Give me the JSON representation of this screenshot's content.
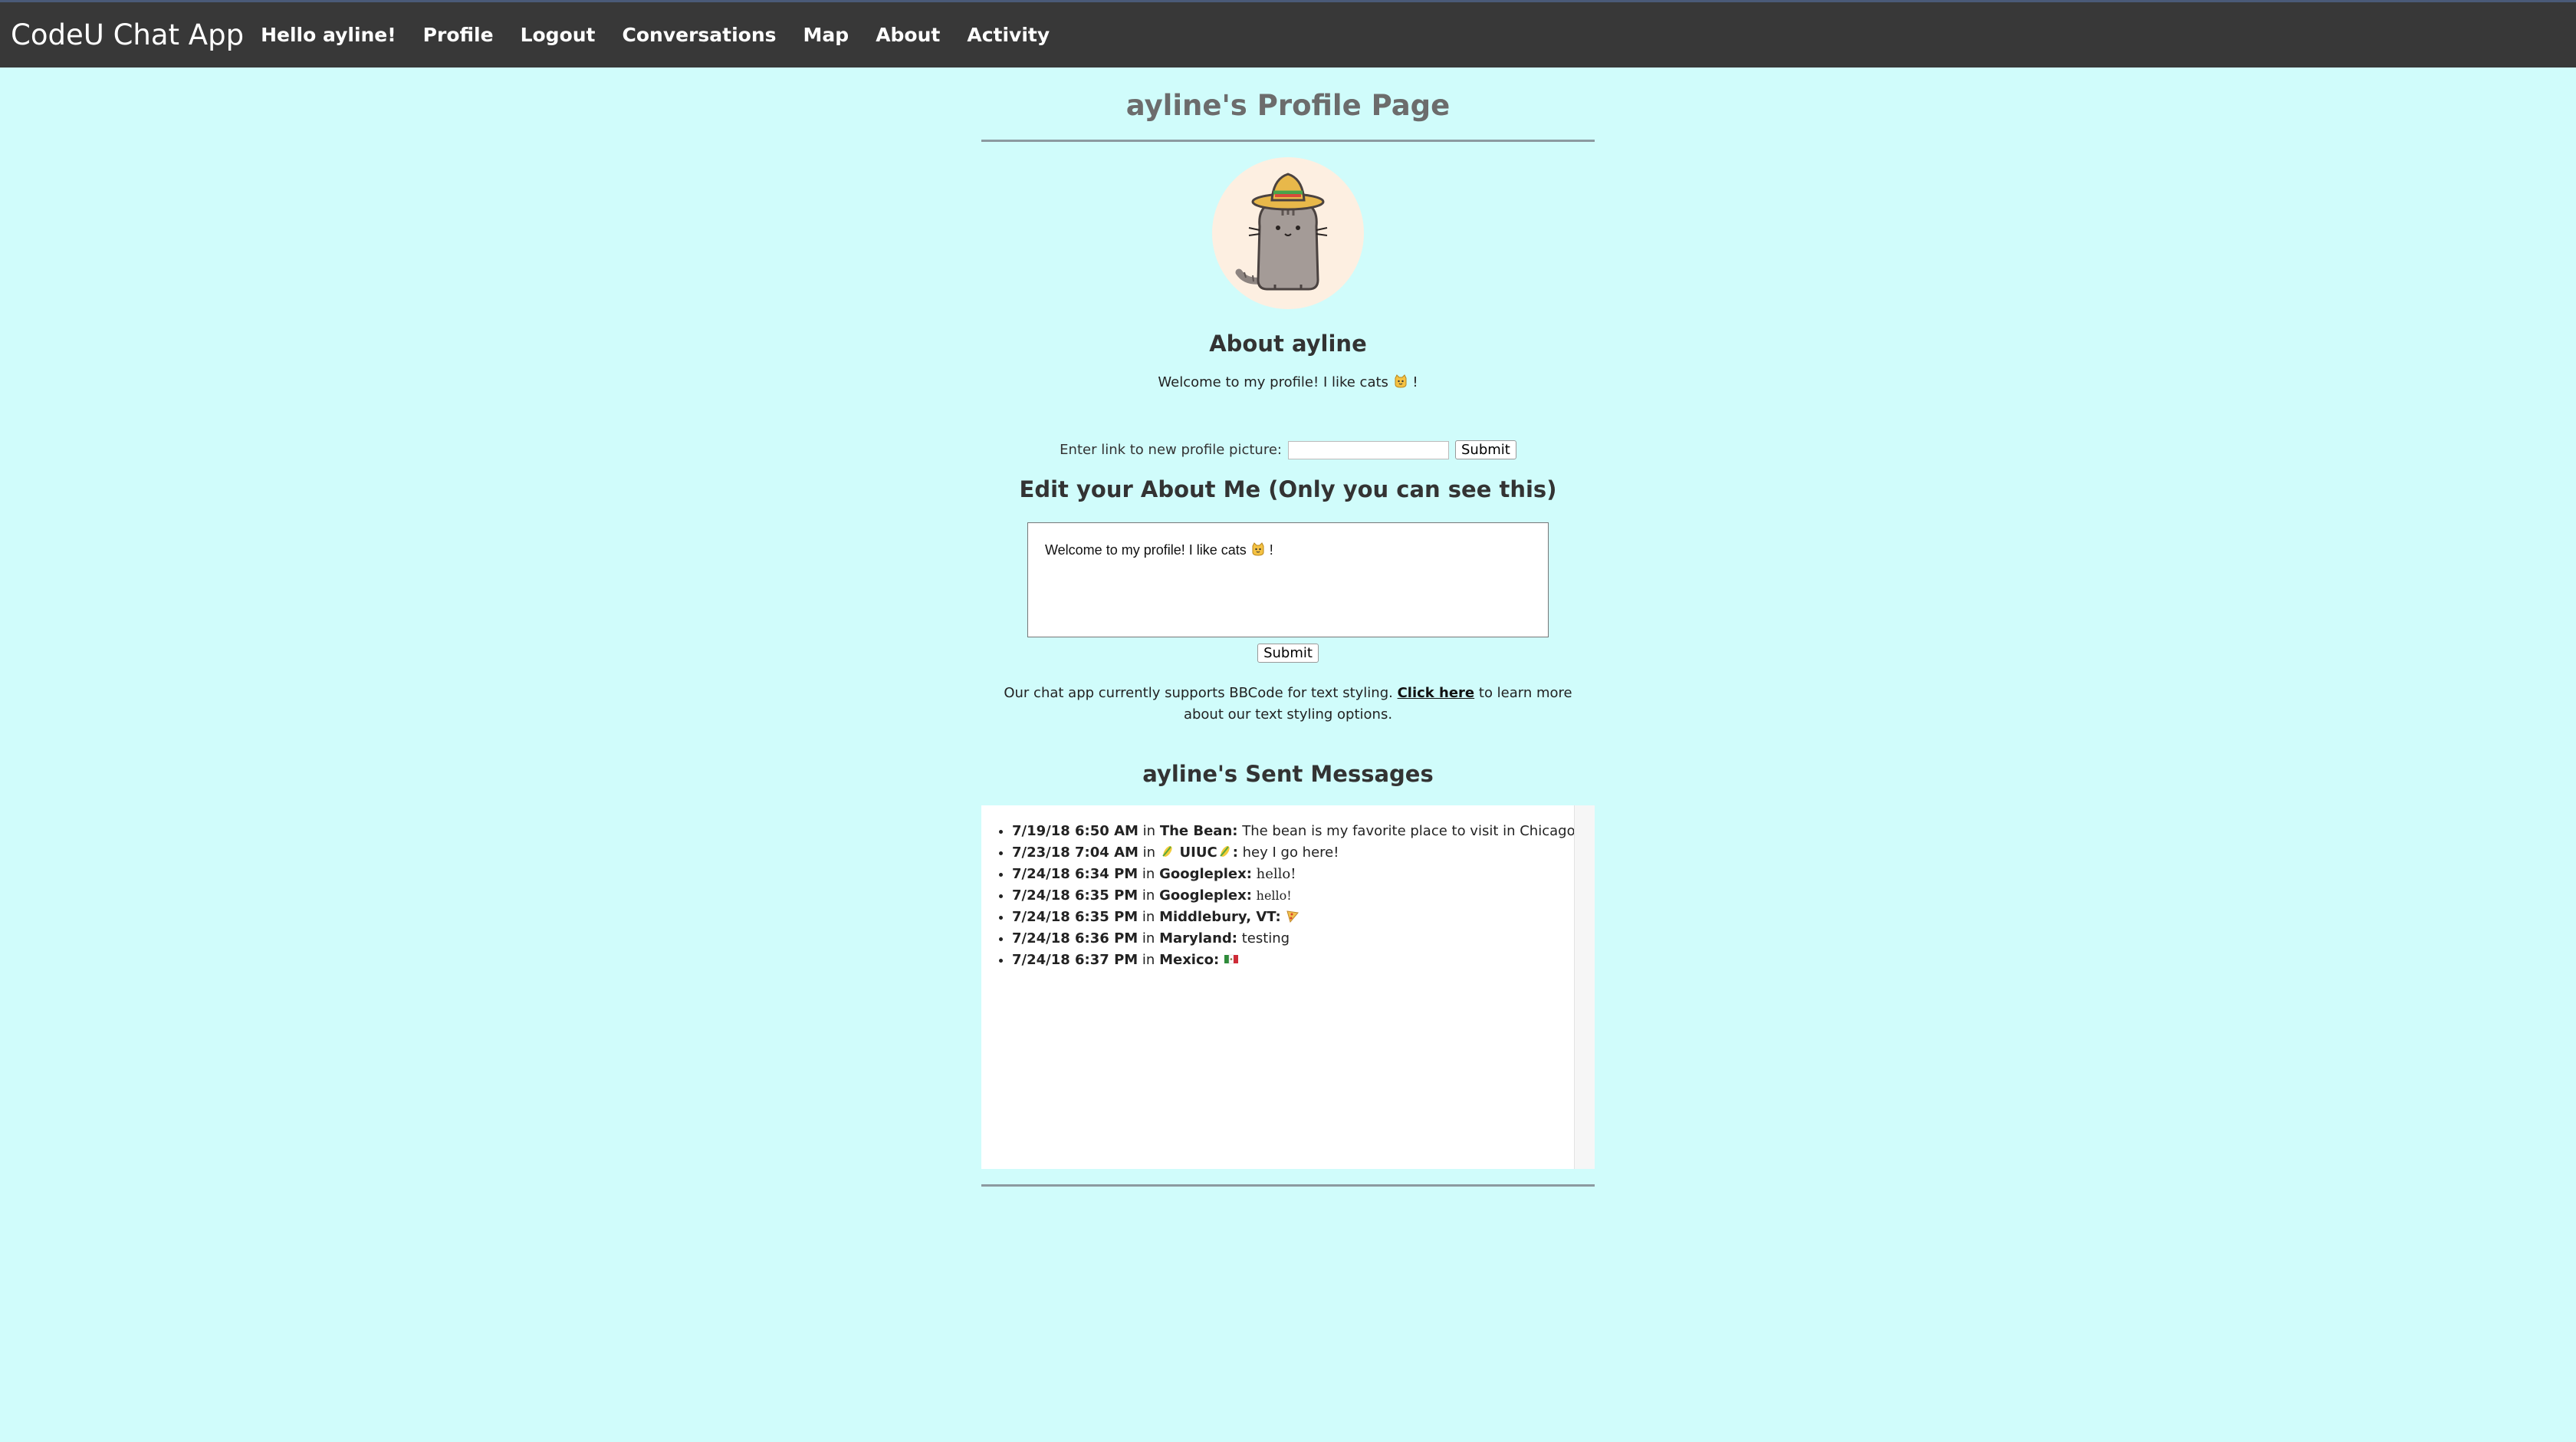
{
  "nav": {
    "brand": "CodeU Chat App",
    "links": [
      "Hello ayline!",
      "Profile",
      "Logout",
      "Conversations",
      "Map",
      "About",
      "Activity"
    ]
  },
  "page": {
    "title": "ayline's Profile Page",
    "avatar_icon": "pusheen-cat-sombrero-icon",
    "about_heading": "About ayline",
    "about_text": "Welcome to my profile! I like cats",
    "about_text_end": "!",
    "picture_label": "Enter link to new profile picture:",
    "picture_input_value": "",
    "picture_submit": "Submit",
    "edit_heading": "Edit your About Me (Only you can see this)",
    "edit_textarea_value": "Welcome to my profile! I like cats",
    "edit_textarea_end": "!",
    "edit_submit": "Submit",
    "bbcode_before": "Our chat app currently supports BBCode for text styling.",
    "bbcode_link": "Click here",
    "bbcode_after": "to learn more about our text styling options.",
    "sent_heading": "ayline's Sent Messages"
  },
  "messages": [
    {
      "time": "7/19/18 6:50 AM",
      "in": "in",
      "conversation": "The Bean:",
      "text": "The bean is my favorite place to visit in Chicago!"
    },
    {
      "time": "7/23/18 7:04 AM",
      "in": "in",
      "conversation": "UIUC",
      "colon": ":",
      "text": "hey I go here!"
    },
    {
      "time": "7/24/18 6:34 PM",
      "in": "in",
      "conversation": "Googleplex:",
      "text": "hello!"
    },
    {
      "time": "7/24/18 6:35 PM",
      "in": "in",
      "conversation": "Googleplex:",
      "text": "hello!"
    },
    {
      "time": "7/24/18 6:35 PM",
      "in": "in",
      "conversation": "Middlebury, VT:",
      "text": ""
    },
    {
      "time": "7/24/18 6:36 PM",
      "in": "in",
      "conversation": "Maryland:",
      "text": "testing"
    },
    {
      "time": "7/24/18 6:37 PM",
      "in": "in",
      "conversation": "Mexico:",
      "text": ""
    }
  ],
  "colors": {
    "background": "#d0fcfb",
    "navbar": "#383838",
    "title": "#6c6c6c"
  }
}
